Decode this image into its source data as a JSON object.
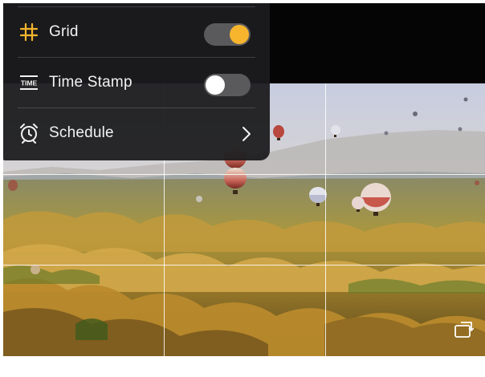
{
  "settings": {
    "grid": {
      "label": "Grid",
      "icon": "grid-icon",
      "enabled": true
    },
    "time_stamp": {
      "label": "Time Stamp",
      "icon": "time-stamp-icon",
      "enabled": false,
      "icon_text": "TIME"
    },
    "schedule": {
      "label": "Schedule",
      "icon": "alarm-clock-icon"
    }
  },
  "camera": {
    "grid_visible": true,
    "switch_icon": "camera-switch-icon"
  },
  "colors": {
    "accent": "#f7b52e",
    "panel": "#1c1c1e",
    "toggle_track": "#5a5a5c"
  }
}
